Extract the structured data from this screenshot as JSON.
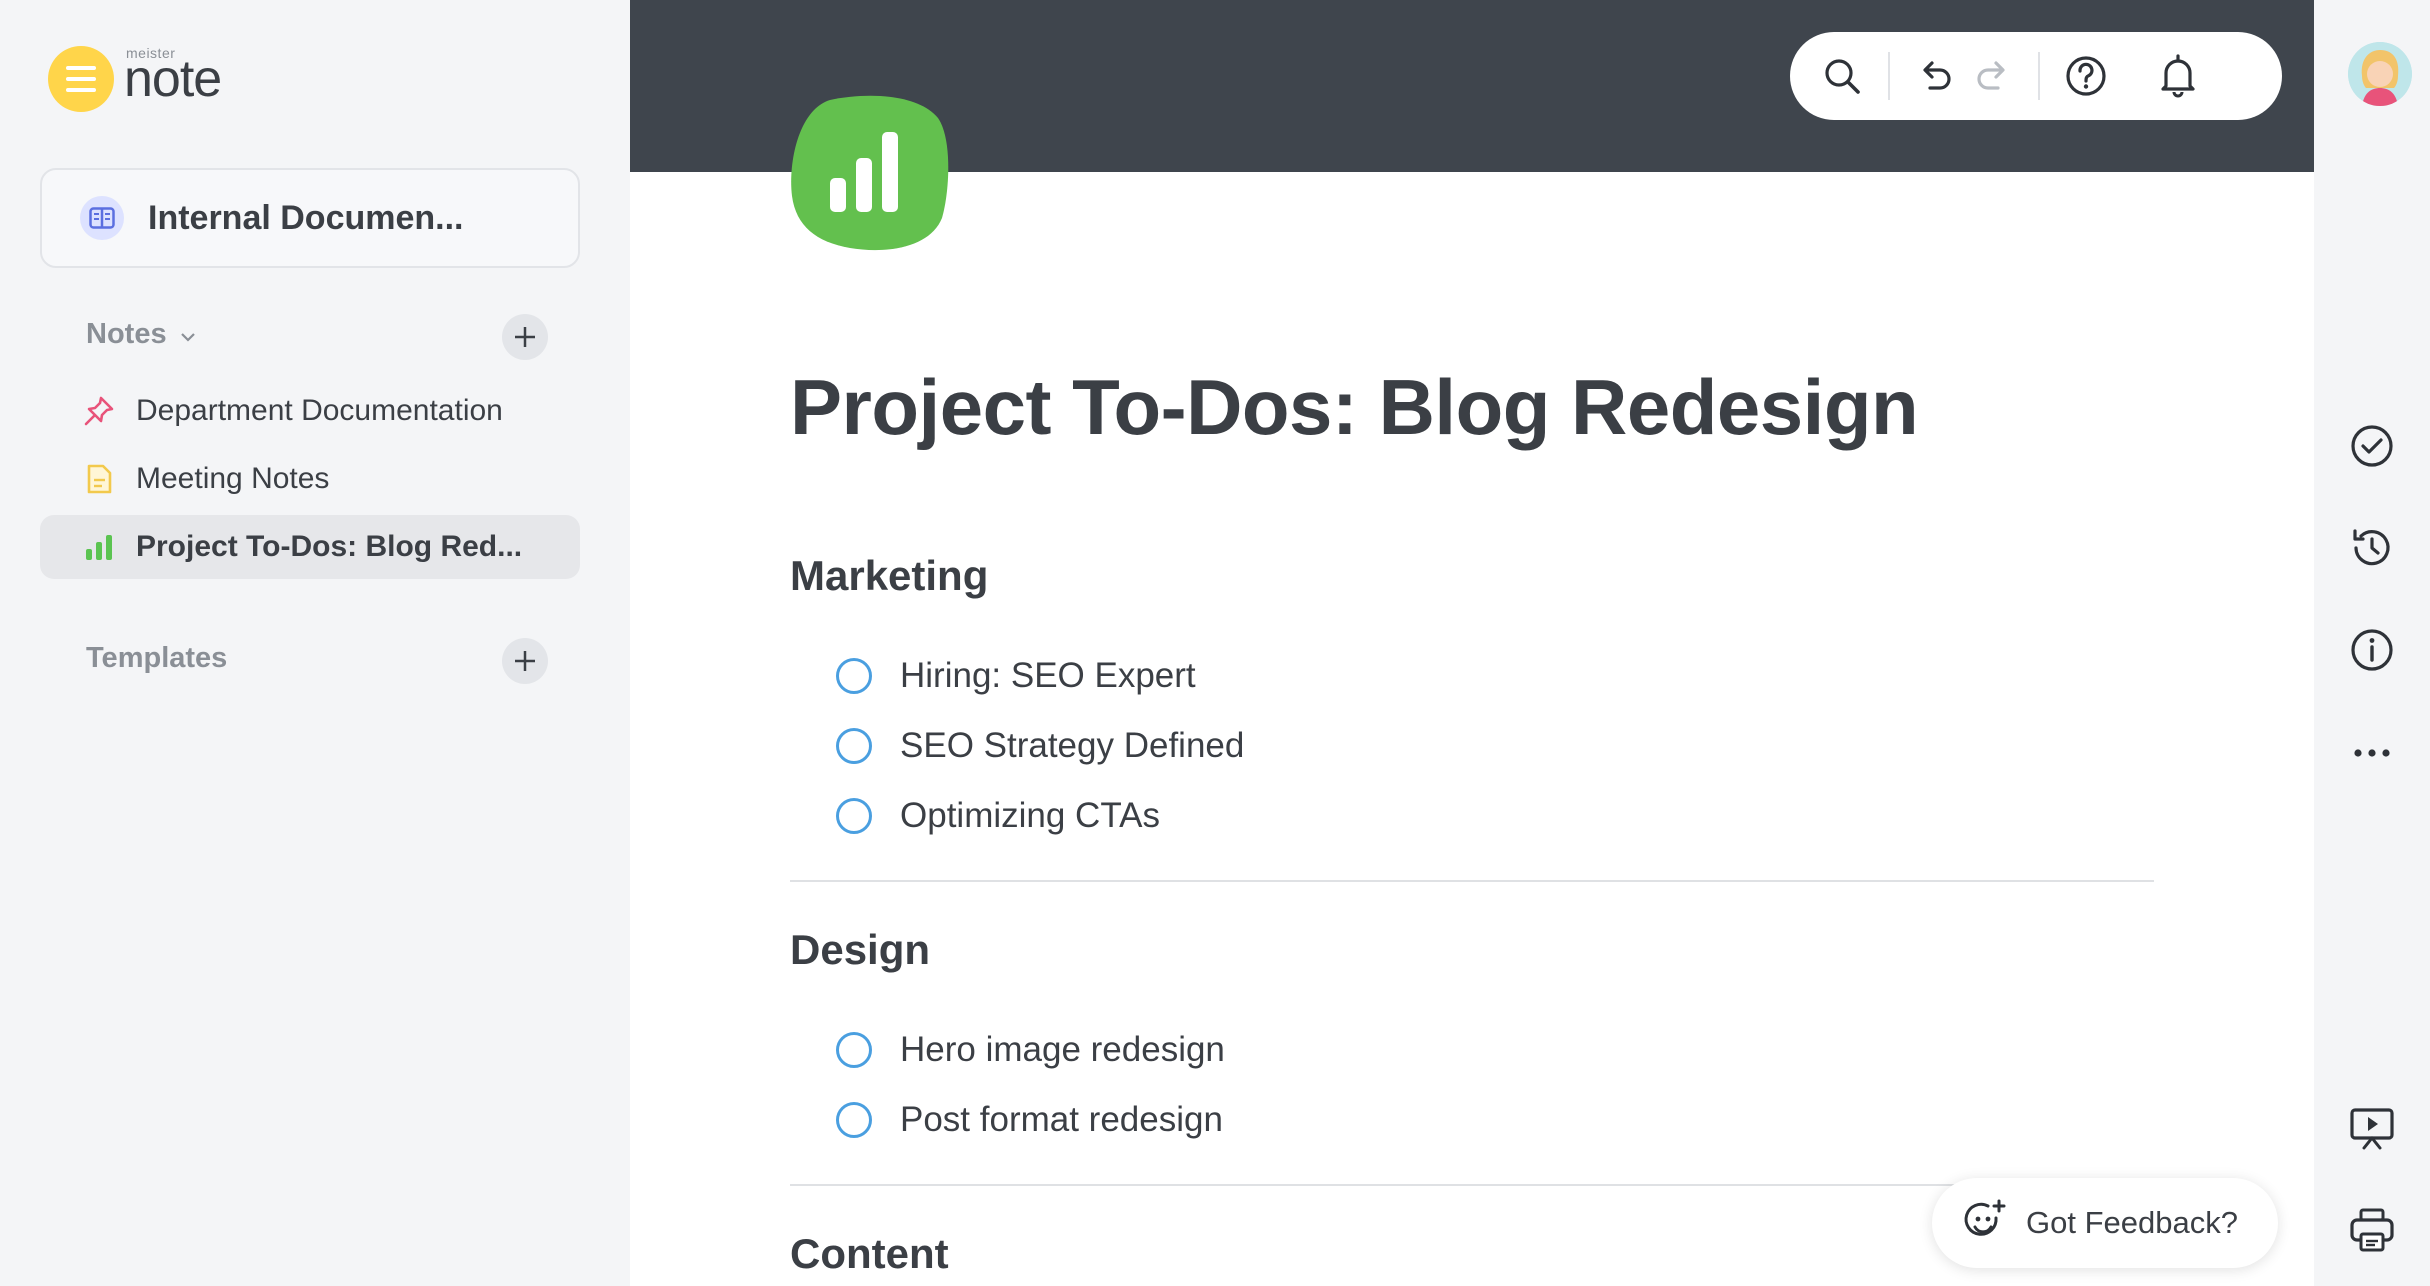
{
  "app": {
    "logo_small": "meister",
    "logo_big": "note",
    "brand_color": "#FFD54A"
  },
  "sidebar": {
    "project_label": "Internal Documen...",
    "notes_header": "Notes",
    "templates_header": "Templates",
    "items": [
      {
        "label": "Department Documentation",
        "icon": "pin-icon",
        "color": "#E8537A"
      },
      {
        "label": "Meeting Notes",
        "icon": "note-page-icon",
        "color": "#F2C94C"
      },
      {
        "label": "Project To-Dos: Blog Red...",
        "icon": "bar-chart-icon",
        "color": "#5BC451",
        "active": true
      }
    ]
  },
  "toolbar": {
    "icons": [
      "search-icon",
      "undo-icon",
      "redo-icon",
      "help-icon",
      "bell-icon"
    ]
  },
  "document": {
    "icon_color": "#63C04E",
    "title": "Project To-Dos: Blog Redesign",
    "sections": [
      {
        "heading": "Marketing",
        "todos": [
          "Hiring: SEO Expert",
          "SEO Strategy Defined",
          "Optimizing CTAs"
        ]
      },
      {
        "heading": "Design",
        "todos": [
          "Hero image redesign",
          "Post format redesign"
        ]
      },
      {
        "heading": "Content",
        "todos": []
      }
    ]
  },
  "feedback": {
    "label": "Got Feedback?"
  },
  "rail": {
    "icons": [
      "check-circle-icon",
      "history-icon",
      "info-icon",
      "more-icon",
      "present-icon",
      "print-icon"
    ]
  },
  "colors": {
    "banner": "#3F454D",
    "checkbox": "#4A9FE0",
    "sidebar_bg": "#F4F5F7"
  }
}
